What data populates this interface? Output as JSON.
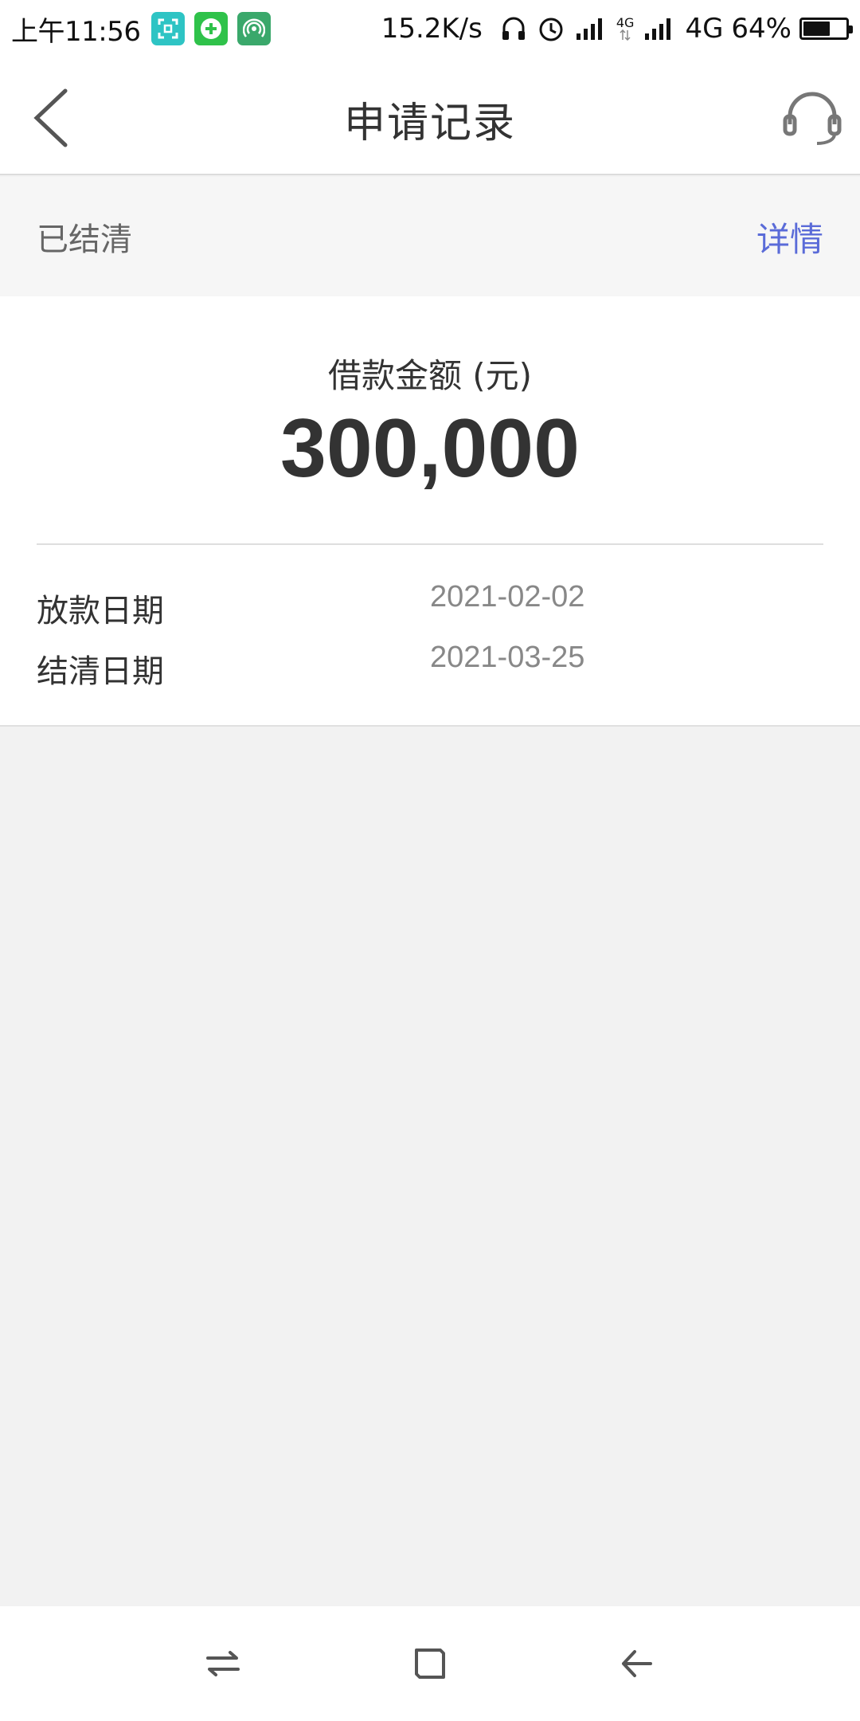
{
  "status_bar": {
    "time": "上午11:56",
    "net_speed": "15.2K/s",
    "network_small": "4G",
    "network": "4G",
    "battery": "64%",
    "battery_level": 0.64
  },
  "nav": {
    "title": "申请记录"
  },
  "record": {
    "status": "已结清",
    "detail_link": "详情",
    "amount_label": "借款金额 (元)",
    "amount": "300,000",
    "rows": [
      {
        "label": "放款日期",
        "value": "2021-02-02"
      },
      {
        "label": "结清日期",
        "value": "2021-03-25"
      }
    ]
  },
  "colors": {
    "accent": "#5a6bd8",
    "app1": "#2ec4c4",
    "app2": "#2fc24a",
    "app3": "#3aa86b"
  }
}
